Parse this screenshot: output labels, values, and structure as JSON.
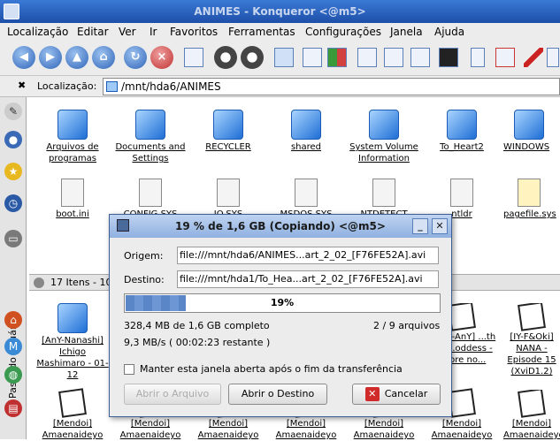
{
  "window": {
    "title": "ANIMES - Konqueror <@m5>"
  },
  "menu": [
    "Localização",
    "Editar",
    "Ver",
    "Ir",
    "Favoritos",
    "Ferramentas",
    "Configurações",
    "Janela",
    "Ajuda"
  ],
  "location": {
    "label": "Localização:",
    "value": "/mnt/hda6/ANIMES"
  },
  "sidebar": {
    "label": "Pasta do Usuário"
  },
  "top_items": [
    {
      "label": "Arquivos de programas",
      "icon": "folder-icon"
    },
    {
      "label": "Documents and Settings",
      "icon": "folder-icon"
    },
    {
      "label": "RECYCLER",
      "icon": "folder-icon"
    },
    {
      "label": "shared",
      "icon": "folder-icon"
    },
    {
      "label": "System Volume Information",
      "icon": "folder-icon"
    },
    {
      "label": "To_Heart2",
      "icon": "folder-icon"
    },
    {
      "label": "WINDOWS",
      "icon": "folder-icon"
    },
    {
      "label": "boot.ini",
      "icon": "text-file-icon"
    },
    {
      "label": "CONFIG.SYS",
      "icon": "file-icon"
    },
    {
      "label": "IO.SYS",
      "icon": "file-icon"
    },
    {
      "label": "MSDOS.SYS",
      "icon": "file-icon"
    },
    {
      "label": "NTDETECT",
      "icon": "file-icon"
    },
    {
      "label": "ntldr",
      "icon": "file-icon"
    },
    {
      "label": "pagefile.sys",
      "icon": "pencil-file-icon"
    }
  ],
  "status": {
    "text": "17 Itens - 10"
  },
  "bottom_items": [
    {
      "label": "[AnY-Nanashi] Ichigo Mashimaro - 01-12"
    },
    {
      "label": "[NinE-AnY] ...th My ...oddess - ...tore no..."
    },
    {
      "label": "[IY-F&Oki] NANA - Episode 15 (XviD1.2)"
    },
    {
      "label": "[Mendoi] Amaenaideyo"
    },
    {
      "label": "[Mendoi] Amaenaideyo"
    },
    {
      "label": "[Mendoi] Amaenaideyo"
    },
    {
      "label": "[Mendoi] Amaenaideyo"
    },
    {
      "label": "[Mendoi] Amaenaideyo"
    },
    {
      "label": "[Mendoi] Amaenaideyo"
    },
    {
      "label": "[Mendoi] Amaenaideyo"
    }
  ],
  "dialog": {
    "title": "19 % de 1,6 GB  (Copiando) <@m5>",
    "origin_label": "Origem:",
    "origin_value": "file:///mnt/hda6/ANIMES...art_2_02_[F76FE52A].avi",
    "dest_label": "Destino:",
    "dest_value": "file:///mnt/hda1/To_Hea...art_2_02_[F76FE52A].avi",
    "progress_text": "19%",
    "progress": 0.19,
    "size_info": "328,4 MB de 1,6 GB completo",
    "files_info": "2 / 9 arquivos",
    "speed_info": "9,3 MB/s ( 00:02:23 restante )",
    "keep_open_label": "Manter esta janela aberta após o fim da transferência",
    "keep_open_checked": false,
    "open_file_label": "Abrir o Arquivo",
    "open_dest_label": "Abrir o Destino",
    "cancel_label": "Cancelar"
  }
}
